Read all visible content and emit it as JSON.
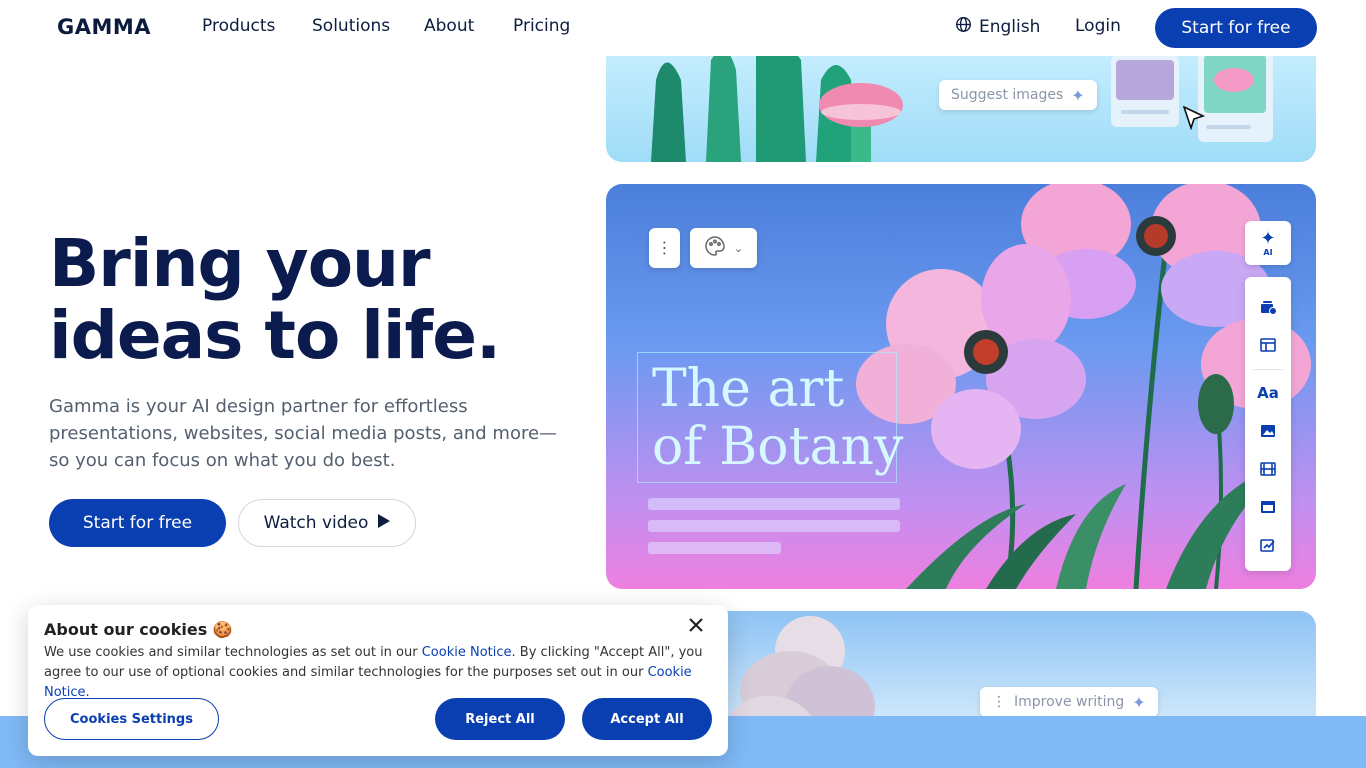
{
  "nav": {
    "logo": "GAMMA",
    "links": [
      "Products",
      "Solutions",
      "About",
      "Pricing"
    ],
    "language": "English",
    "login": "Login",
    "cta": "Start for free"
  },
  "hero": {
    "title_line1": "Bring your",
    "title_line2": "ideas to life.",
    "subtitle": "Gamma is your AI design partner for effortless presentations, websites, social media posts, and more—so you can focus on what you do best.",
    "primary_button": "Start for free",
    "secondary_button": "Watch video"
  },
  "visual": {
    "suggest_chip": "Suggest images",
    "art_line1": "The art",
    "art_line2": "of Botany",
    "ai_badge": "AI",
    "improve_chip": "Improve writing"
  },
  "cookie": {
    "title": "About our cookies",
    "emoji": "🍪",
    "text_1": "We use cookies and similar technologies as set out in our ",
    "link_1": "Cookie Notice",
    "text_2": ". By clicking \"Accept All\", you agree to our use of optional cookies and similar technologies for the purposes set out in our ",
    "link_2": "Cookie Notice",
    "text_3": ".",
    "settings_button": "Cookies Settings",
    "reject_button": "Reject All",
    "accept_button": "Accept All"
  },
  "colors": {
    "brand": "#0a3fb1",
    "heading": "#0b1b4d",
    "band": "#7fb9f6"
  }
}
